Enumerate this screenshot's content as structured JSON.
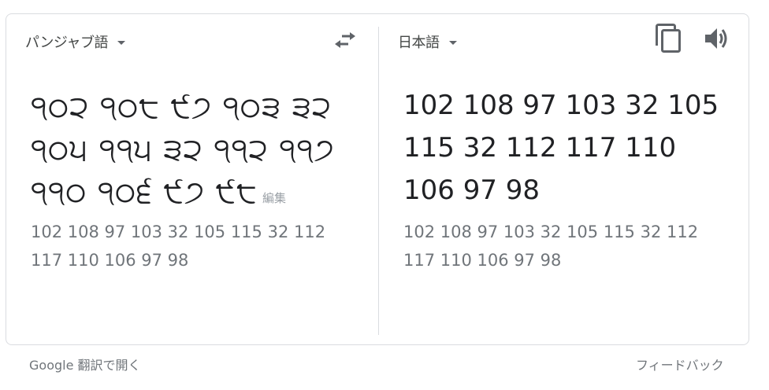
{
  "source": {
    "language_label": "パンジャブ語",
    "text": "੧੦੨ ੧੦੮ ੯੭ ੧੦੩ ੩੨ ੧੦੫ ੧੧੫ ੩੨ ੧੧੨ ੧੧੭ ੧੧੦ ੧੦੬ ੯੭ ੯੮",
    "edit_label": "編集",
    "transliteration": "102 108 97 103 32 105 115 32 112 117 110 106 97 98"
  },
  "swap_icon": "swap-horiz-icon",
  "target": {
    "language_label": "日本語",
    "text": "102 108 97 103 32 105 115 32 112 117 110 106 97 98",
    "transliteration": "102 108 97 103 32 105 115 32 112 117 110 106 97 98",
    "copy_icon": "copy-icon",
    "speaker_icon": "speaker-icon"
  },
  "footer": {
    "open_link": "Google 翻訳で開く",
    "feedback_link": "フィードバック"
  }
}
